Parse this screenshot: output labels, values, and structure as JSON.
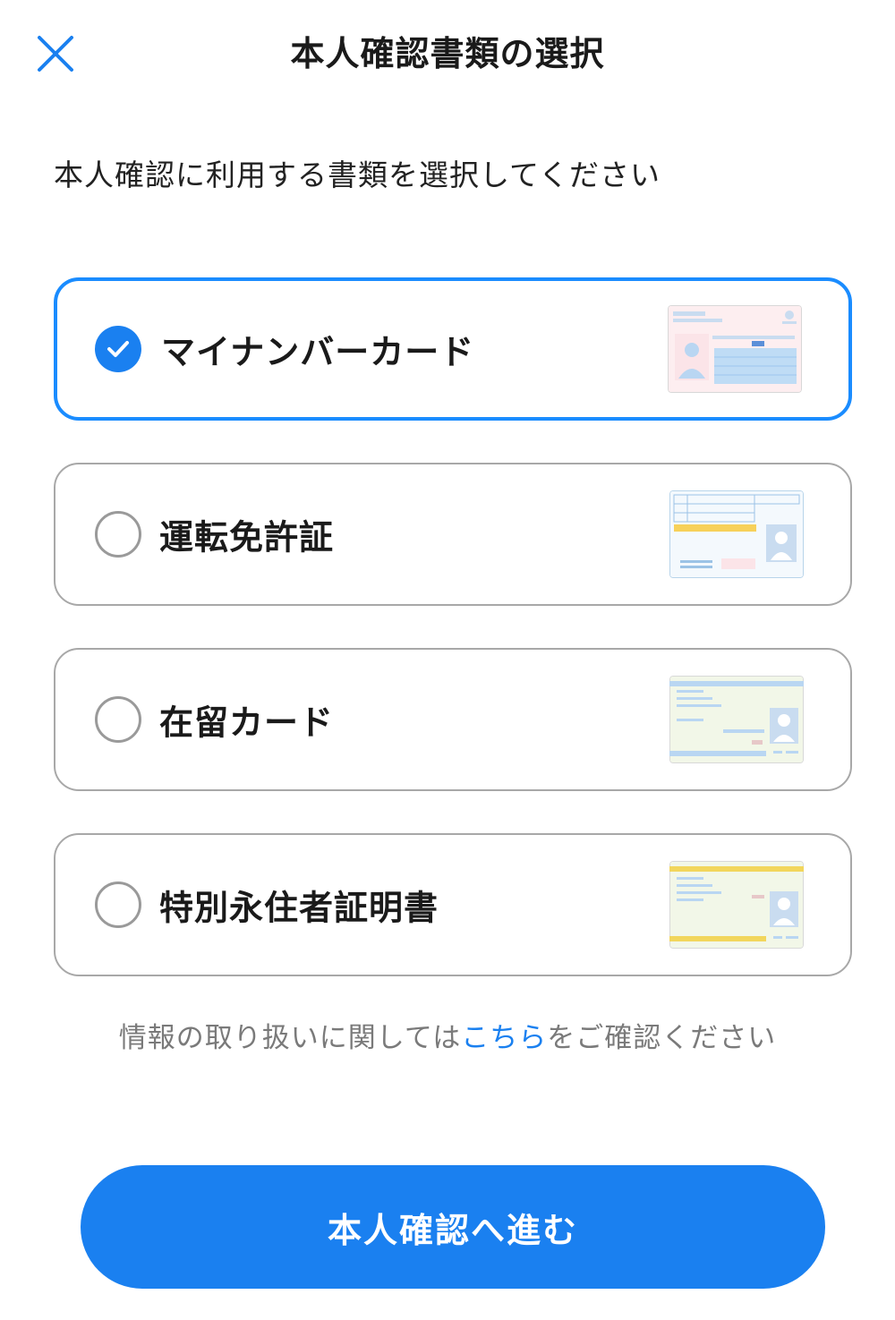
{
  "header": {
    "title": "本人確認書類の選択",
    "close_icon": "close-icon"
  },
  "instruction": "本人確認に利用する書類を選択してください",
  "options": [
    {
      "label": "マイナンバーカード",
      "selected": true,
      "icon": "my-number-card-icon"
    },
    {
      "label": "運転免許証",
      "selected": false,
      "icon": "drivers-license-icon"
    },
    {
      "label": "在留カード",
      "selected": false,
      "icon": "residence-card-icon"
    },
    {
      "label": "特別永住者証明書",
      "selected": false,
      "icon": "special-permanent-resident-certificate-icon"
    }
  ],
  "info": {
    "prefix": "情報の取り扱いに関しては",
    "link": "こちら",
    "suffix": "をご確認ください"
  },
  "primary_button": "本人確認へ進む",
  "colors": {
    "accent": "#1a80f0",
    "border": "#a8a8a8"
  }
}
